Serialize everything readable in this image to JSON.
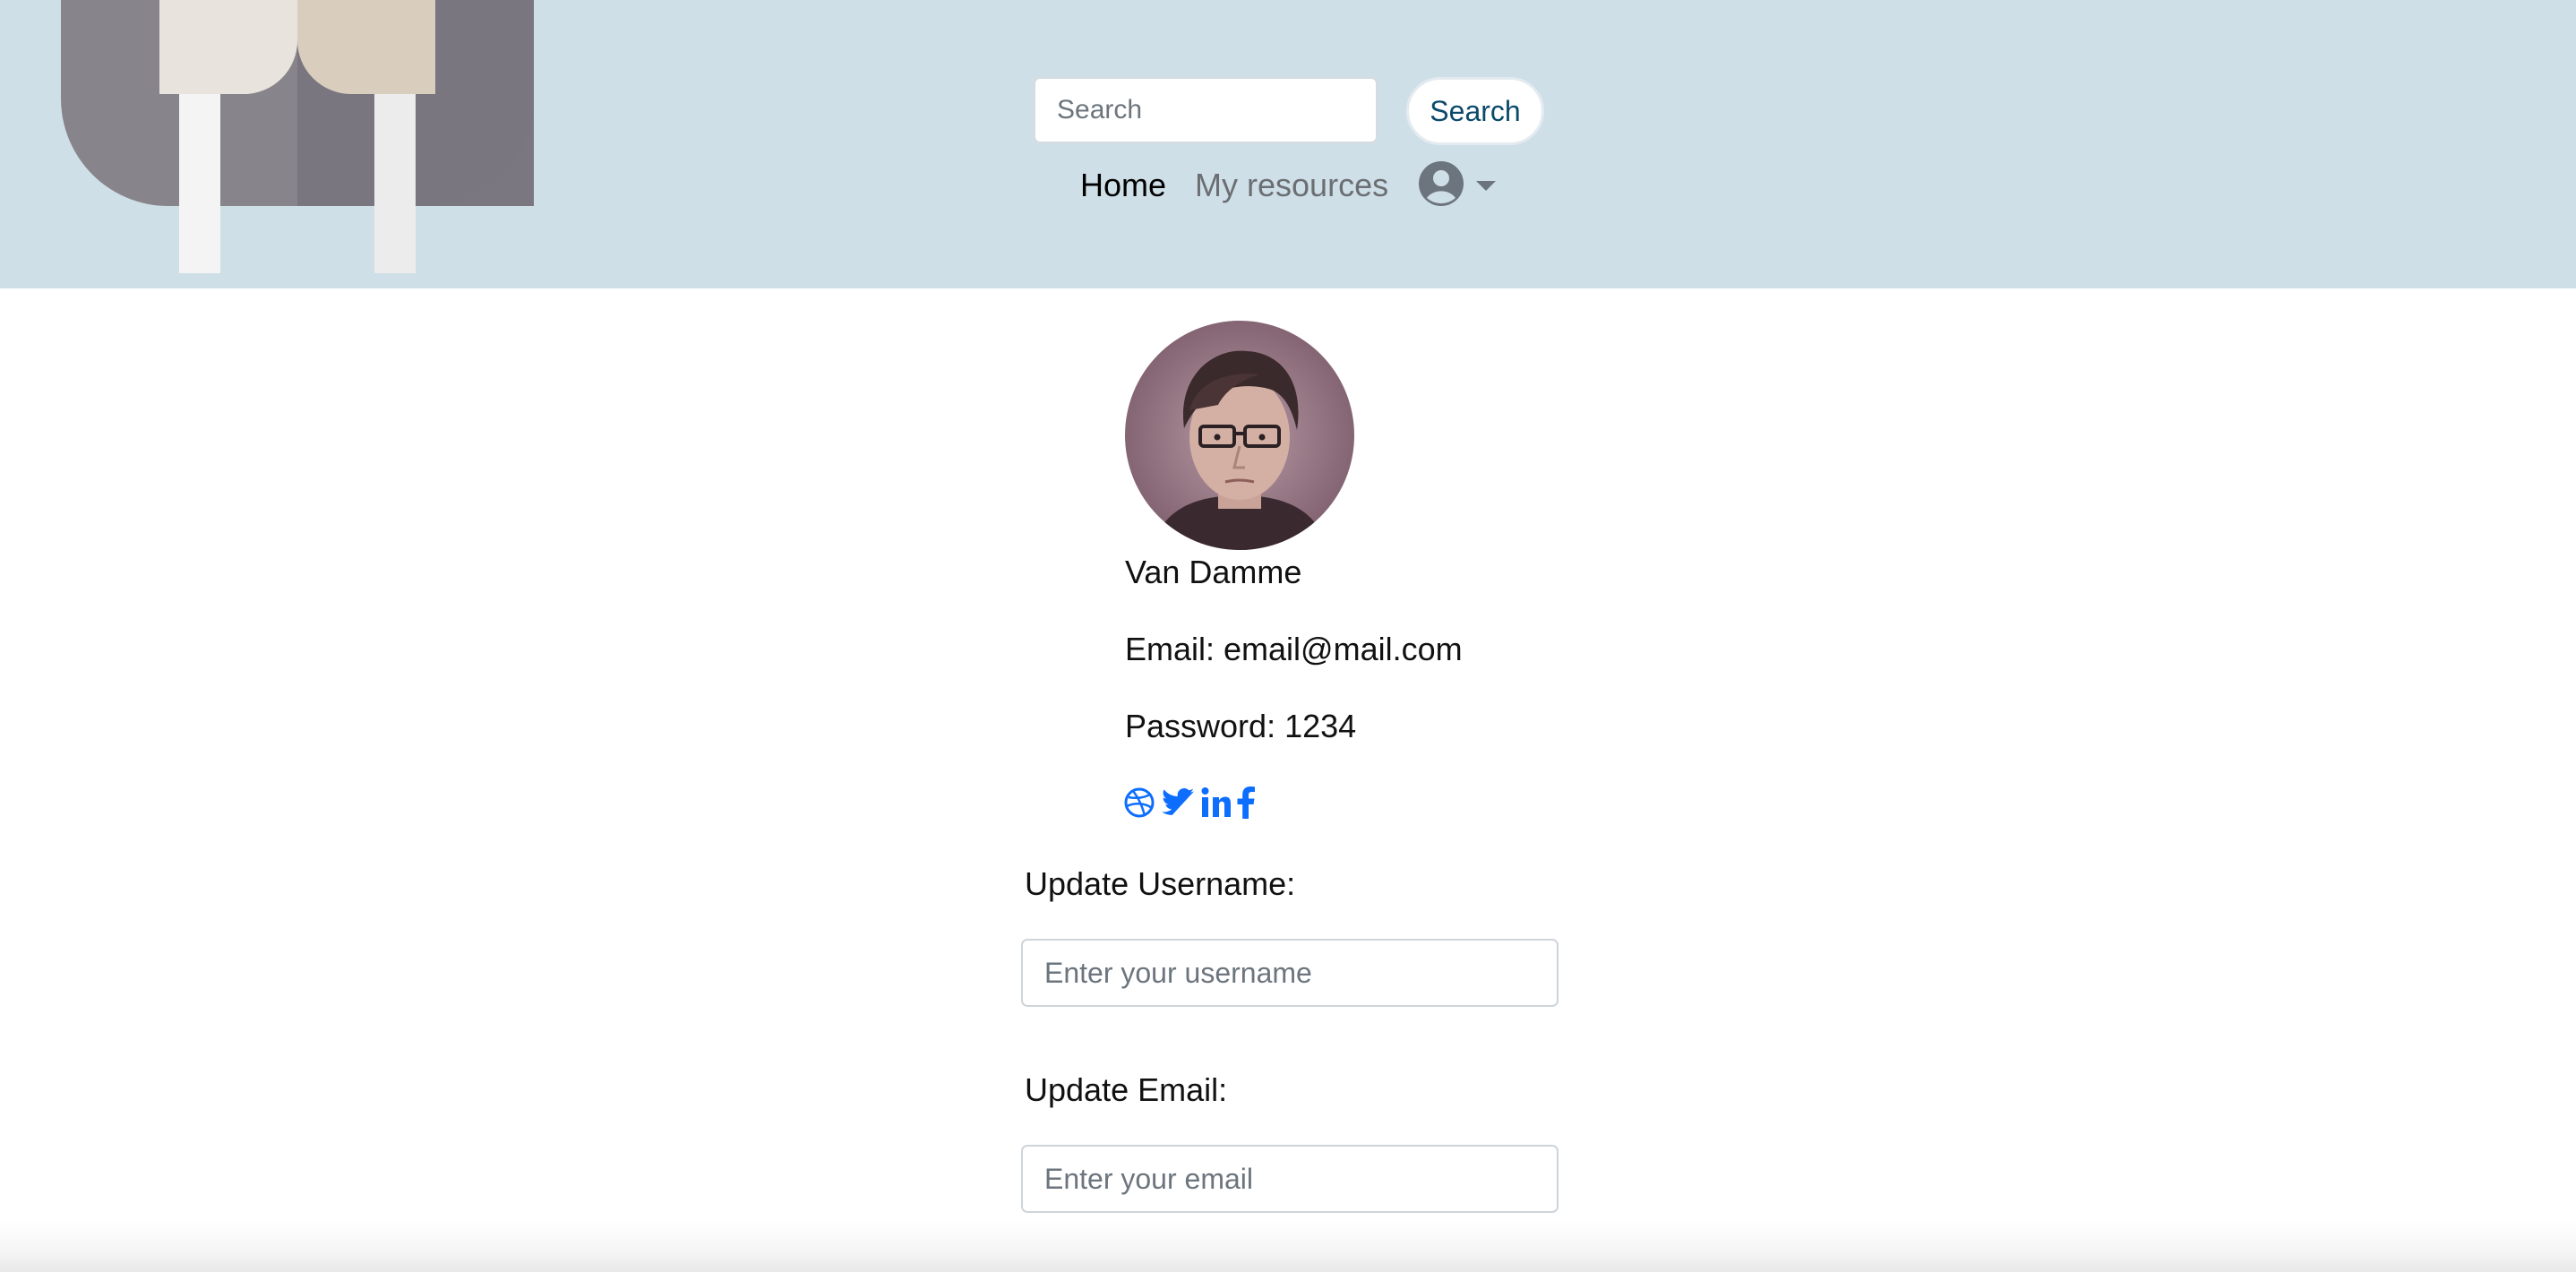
{
  "header": {
    "search": {
      "placeholder": "Search",
      "button_label": "Search"
    },
    "nav": {
      "home_label": "Home",
      "resources_label": "My resources",
      "user_icon": "user-circle-icon",
      "caret_icon": "caret-down-icon"
    }
  },
  "profile": {
    "name": "Van Damme",
    "email": "Email: email@mail.com",
    "password": "Password: 1234",
    "socials": [
      "dribbble-icon",
      "twitter-icon",
      "linkedin-icon",
      "facebook-icon"
    ],
    "social_color": "#0d6efd"
  },
  "form": {
    "username_label": "Update Username:",
    "username_placeholder": "Enter your username",
    "email_label": "Update Email:",
    "email_placeholder": "Enter your email"
  },
  "colors": {
    "header_bg": "#cfdfe7",
    "search_button_text": "#0b4a6b",
    "link_blue": "#0d6efd"
  }
}
